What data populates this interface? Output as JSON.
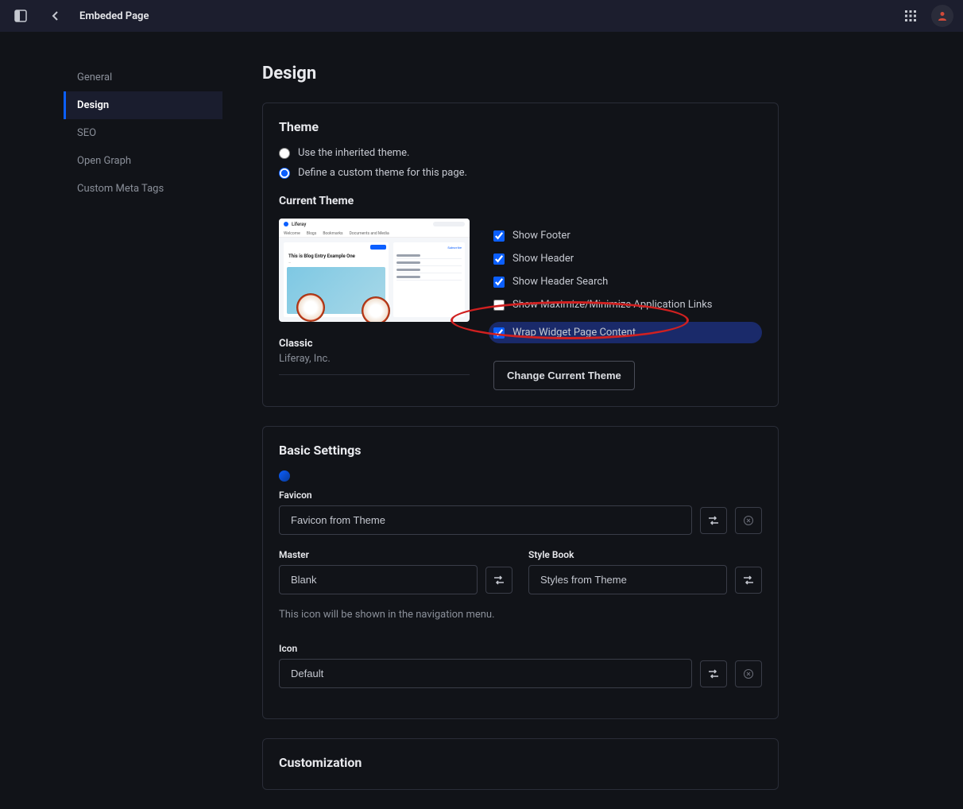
{
  "topbar": {
    "title": "Embeded Page"
  },
  "sidebar": {
    "items": [
      {
        "label": "General"
      },
      {
        "label": "Design"
      },
      {
        "label": "SEO"
      },
      {
        "label": "Open Graph"
      },
      {
        "label": "Custom Meta Tags"
      }
    ]
  },
  "section_title": "Design",
  "theme": {
    "heading": "Theme",
    "radio_inherited": "Use the inherited theme.",
    "radio_custom": "Define a custom theme for this page.",
    "current_heading": "Current Theme",
    "preview": {
      "logo": "Liferay",
      "nav": [
        "Welcome",
        "Blogs",
        "Bookmarks",
        "Documents and Media"
      ],
      "title": "This is Blog Entry Example One",
      "side_entries": [
        "September 2017 Entries",
        "October 2017 Entries",
        "November 2017 Entries",
        "December 2017 Entries"
      ],
      "subscribe": "Subscribe"
    },
    "name": "Classic",
    "vendor": "Liferay, Inc.",
    "checks": [
      {
        "label": "Show Footer",
        "checked": true
      },
      {
        "label": "Show Header",
        "checked": true
      },
      {
        "label": "Show Header Search",
        "checked": true
      },
      {
        "label": "Show Maximize/Minimize Application Links",
        "checked": false
      },
      {
        "label": "Wrap Widget Page Content",
        "checked": true
      }
    ],
    "change_btn": "Change Current Theme"
  },
  "basic": {
    "heading": "Basic Settings",
    "favicon_label": "Favicon",
    "favicon_value": "Favicon from Theme",
    "master_label": "Master",
    "master_value": "Blank",
    "stylebook_label": "Style Book",
    "stylebook_value": "Styles from Theme",
    "hint": "This icon will be shown in the navigation menu.",
    "icon_label": "Icon",
    "icon_value": "Default"
  },
  "customization": {
    "heading": "Customization"
  }
}
